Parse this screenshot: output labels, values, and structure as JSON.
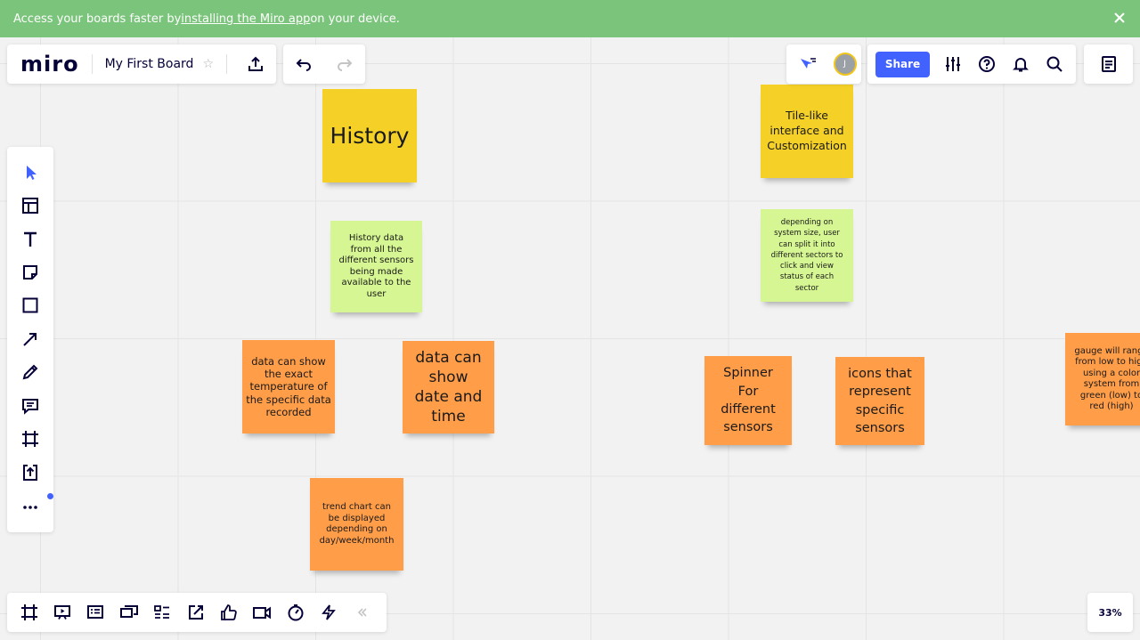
{
  "banner": {
    "text_before": "Access your boards faster by ",
    "link": "installing the Miro app",
    "text_after": " on your device."
  },
  "header": {
    "logo": "miro",
    "board_title": "My First Board",
    "avatar_initial": "J",
    "share_label": "Share"
  },
  "stickies": {
    "history_title": "History",
    "history_data": "History data from all the different sensors being made available to the user",
    "temperature": "data can show the exact temperature of the specific data recorded",
    "date_time": "data can show date and time",
    "trend_chart": "trend chart can be displayed depending on day/week/month",
    "tile_interface": "Tile-like interface and Customization",
    "sectors": "depending on system size, user can split it into different sectors to click and view status of each sector",
    "spinner": "Spinner For different sensors",
    "icons_sensors": "icons that represent specific sensors",
    "gauge": "gauge will range from low to high using a color system from green (low) to red (high)"
  },
  "zoom": {
    "level": "33%"
  },
  "colors": {
    "banner": "#7bc47b",
    "accent": "#4262ff",
    "sticky_yellow": "#f5d128",
    "sticky_green": "#d5f692",
    "sticky_orange": "#ff9d48"
  }
}
